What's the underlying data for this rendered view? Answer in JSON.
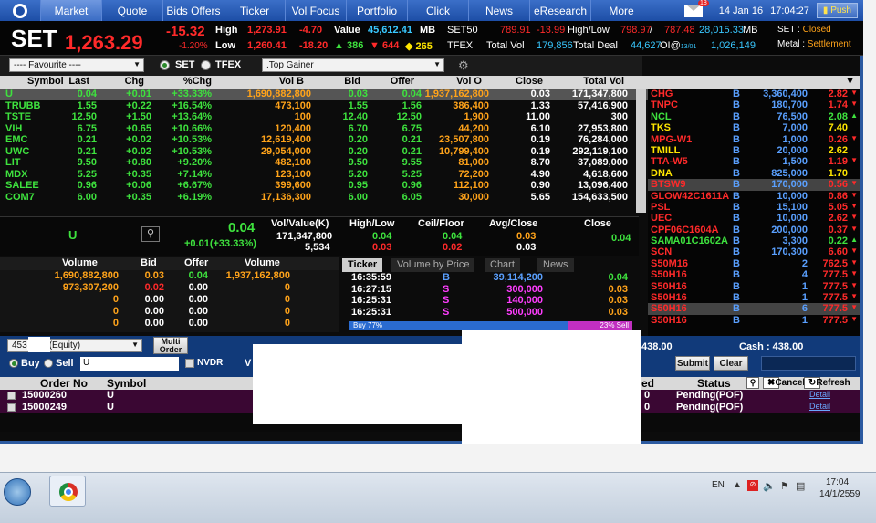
{
  "nav": {
    "tabs": [
      "Market",
      "Quote",
      "Bids Offers",
      "Ticker",
      "Vol Focus",
      "Portfolio",
      "Click",
      "News",
      "eResearch",
      "More"
    ],
    "mail_count": "18",
    "date": "14 Jan 16",
    "time": "17:04:27",
    "push": "Push"
  },
  "index": {
    "name": "SET",
    "value": "1,263.29",
    "change": "-15.32",
    "pct": "-1.20%",
    "high_label": "High",
    "high": "1,273.91",
    "high_chg": "-4.70",
    "low_label": "Low",
    "low": "1,260.41",
    "low_chg": "-18.20",
    "value_label": "Value",
    "value_mb": "45,612.41",
    "mb": "MB",
    "up": "386",
    "down": "644",
    "unch": "265",
    "set50": "SET50",
    "set50_val": "789.91",
    "set50_chg": "-13.99",
    "hl_label": "High/Low",
    "hl_val": "798.97",
    "hl_val2": "787.48",
    "set50_mb": "28,015.33",
    "tfex": "TFEX",
    "total_vol_label": "Total Vol",
    "total_vol": "179,856",
    "total_deal_label": "Total Deal",
    "total_deal": "44,627",
    "oi_label": "OI@",
    "oi_date": "13/01",
    "oi": "1,026,149",
    "set_status_label": "SET : ",
    "set_status": "Closed",
    "metal_label": "Metal : ",
    "metal_status": "Settlement"
  },
  "filter": {
    "favourite": "---- Favourite ----",
    "radio_set": "SET",
    "radio_tfex": "TFEX",
    "list": ".Top Gainer"
  },
  "grid": {
    "headers": [
      "Symbol",
      "Last",
      "Chg",
      "%Chg",
      "Vol B",
      "Bid",
      "Offer",
      "Vol O",
      "Close",
      "Total Vol"
    ],
    "rows": [
      [
        "U",
        "0.04",
        "+0.01",
        "+33.33%",
        "1,690,882,800",
        "0.03",
        "0.04",
        "1,937,162,800",
        "0.03",
        "171,347,800"
      ],
      [
        "TRUBB",
        "1.55",
        "+0.22",
        "+16.54%",
        "473,100",
        "1.55",
        "1.56",
        "386,400",
        "1.33",
        "57,416,900"
      ],
      [
        "TSTE",
        "12.50",
        "+1.50",
        "+13.64%",
        "100",
        "12.40",
        "12.50",
        "1,900",
        "11.00",
        "300"
      ],
      [
        "VIH",
        "6.75",
        "+0.65",
        "+10.66%",
        "120,400",
        "6.70",
        "6.75",
        "44,200",
        "6.10",
        "27,953,800"
      ],
      [
        "EMC",
        "0.21",
        "+0.02",
        "+10.53%",
        "12,619,400",
        "0.20",
        "0.21",
        "23,507,800",
        "0.19",
        "76,284,000"
      ],
      [
        "UWC",
        "0.21",
        "+0.02",
        "+10.53%",
        "29,054,000",
        "0.20",
        "0.21",
        "10,799,400",
        "0.19",
        "292,119,100"
      ],
      [
        "LIT",
        "9.50",
        "+0.80",
        "+9.20%",
        "482,100",
        "9.50",
        "9.55",
        "81,000",
        "8.70",
        "37,089,000"
      ],
      [
        "MDX",
        "5.25",
        "+0.35",
        "+7.14%",
        "123,100",
        "5.20",
        "5.25",
        "72,200",
        "4.90",
        "4,618,600"
      ],
      [
        "SALEE",
        "0.96",
        "+0.06",
        "+6.67%",
        "399,600",
        "0.95",
        "0.96",
        "112,100",
        "0.90",
        "13,096,400"
      ],
      [
        "COM7",
        "6.00",
        "+0.35",
        "+6.19%",
        "17,136,300",
        "6.00",
        "6.05",
        "30,000",
        "5.65",
        "154,633,500"
      ]
    ]
  },
  "right": {
    "rows": [
      [
        "CHG",
        "B",
        "3,360,400",
        "2.82",
        "down"
      ],
      [
        "TNPC",
        "B",
        "180,700",
        "1.74",
        "down"
      ],
      [
        "NCL",
        "B",
        "76,500",
        "2.08",
        "up"
      ],
      [
        "TKS",
        "B",
        "7,000",
        "7.40",
        "none"
      ],
      [
        "MPG-W1",
        "B",
        "1,000",
        "0.26",
        "down"
      ],
      [
        "TMILL",
        "B",
        "20,000",
        "2.62",
        "none"
      ],
      [
        "TTA-W5",
        "B",
        "1,500",
        "1.19",
        "down"
      ],
      [
        "DNA",
        "B",
        "825,000",
        "1.70",
        "none"
      ],
      [
        "BTSW9",
        "B",
        "170,000",
        "0.56",
        "down"
      ],
      [
        "GLOW42C1611A",
        "B",
        "10,000",
        "0.86",
        "down"
      ],
      [
        "PSL",
        "B",
        "15,100",
        "5.05",
        "down"
      ],
      [
        "UEC",
        "B",
        "10,000",
        "2.62",
        "down"
      ],
      [
        "CPF06C1604A",
        "B",
        "200,000",
        "0.37",
        "down"
      ],
      [
        "SAMA01C1602A",
        "B",
        "3,300",
        "0.22",
        "up"
      ],
      [
        "SCN",
        "B",
        "170,300",
        "6.60",
        "down"
      ],
      [
        "S50M16",
        "B",
        "2",
        "762.5",
        "down"
      ],
      [
        "S50H16",
        "B",
        "4",
        "777.5",
        "down"
      ],
      [
        "S50H16",
        "B",
        "1",
        "777.5",
        "down"
      ],
      [
        "S50H16",
        "B",
        "1",
        "777.5",
        "down"
      ],
      [
        "S50H16",
        "B",
        "6",
        "777.5",
        "down"
      ],
      [
        "S50H16",
        "B",
        "1",
        "777.5",
        "down"
      ]
    ]
  },
  "detail": {
    "symbol": "U",
    "last": "0.04",
    "chg": "+0.01(+33.33%)",
    "vv_label": "Vol/Value(K)",
    "vol": "171,347,800",
    "value": "5,534",
    "hl_label": "High/Low",
    "high": "0.04",
    "low": "0.03",
    "cf_label": "Ceil/Floor",
    "ceil": "0.04",
    "floor": "0.02",
    "ac_label": "Avg/Close",
    "avg": "0.03",
    "close": "0.03",
    "close_label": "Close",
    "close_val": "0.04"
  },
  "quote": {
    "headers": [
      "Volume",
      "Bid",
      "Offer",
      "Volume"
    ],
    "rows": [
      [
        "1,690,882,800",
        "0.03",
        "0.04",
        "1,937,162,800"
      ],
      [
        "973,307,200",
        "0.02",
        "0.00",
        "0"
      ],
      [
        "0",
        "0.00",
        "0.00",
        "0"
      ],
      [
        "0",
        "0.00",
        "0.00",
        "0"
      ],
      [
        "0",
        "0.00",
        "0.00",
        "0"
      ]
    ]
  },
  "ticker": {
    "tabs": [
      "Ticker",
      "Volume by Price",
      "Chart",
      "News"
    ],
    "rows": [
      [
        "16:35:59",
        "B",
        "39,114,200",
        "0.04"
      ],
      [
        "16:27:15",
        "S",
        "300,000",
        "0.03"
      ],
      [
        "16:25:31",
        "S",
        "140,000",
        "0.03"
      ],
      [
        "16:25:31",
        "S",
        "500,000",
        "0.03"
      ]
    ],
    "buy": "Buy  77%",
    "sell": "23%  Sell",
    "buy_pct": 0.77
  },
  "order": {
    "account": "453",
    "acct_type": "(Equity)",
    "multi": "Multi Order",
    "buy": "Buy",
    "sell": "Sell",
    "symbol": "U",
    "nvdr": "NVDR",
    "v_label": "V",
    "cash_value": "438.00",
    "cash": "Cash : 438.00",
    "submit": "Submit",
    "clear": "Clear"
  },
  "orders": {
    "headers": [
      "Order No",
      "Symbol",
      "ed",
      "Status",
      "Cancel",
      "Refresh"
    ],
    "rows": [
      [
        "15000260",
        "U",
        "0",
        "Pending(POF)",
        "Detail"
      ],
      [
        "15000249",
        "U",
        "0",
        "Pending(POF)",
        "Detail"
      ]
    ]
  },
  "taskbar": {
    "lang": "EN",
    "time": "17:04",
    "date": "14/1/2559"
  },
  "colors": {
    "nav": "#2c5aa0",
    "up": "#3ee23e",
    "down": "#ff2a2a",
    "unchanged": "#ffe600"
  }
}
